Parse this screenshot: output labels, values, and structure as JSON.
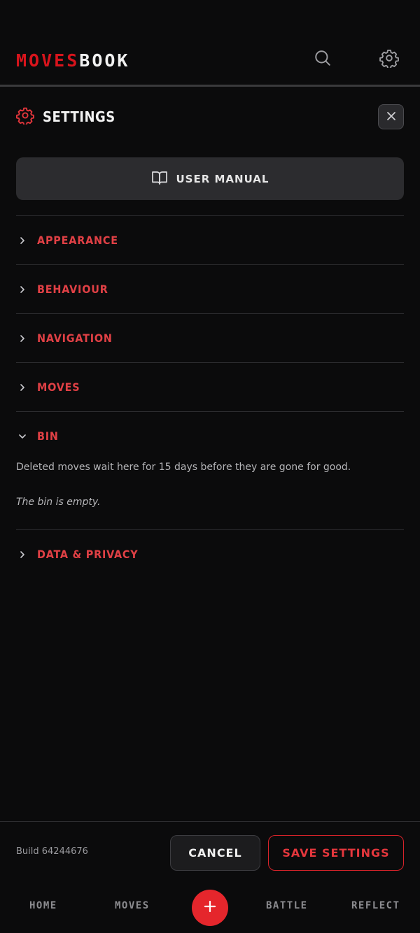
{
  "header": {
    "logo_red": "MOVES",
    "logo_white": "BOOK"
  },
  "settings": {
    "title": "SETTINGS",
    "manual_label": "USER MANUAL",
    "sections": [
      {
        "label": "APPEARANCE",
        "expanded": false
      },
      {
        "label": "BEHAVIOUR",
        "expanded": false
      },
      {
        "label": "NAVIGATION",
        "expanded": false
      },
      {
        "label": "MOVES",
        "expanded": false
      },
      {
        "label": "BIN",
        "expanded": true
      },
      {
        "label": "DATA & PRIVACY",
        "expanded": false
      }
    ],
    "bin": {
      "description": "Deleted moves wait here for 15 days before they are gone for good.",
      "empty_text": "The bin is empty."
    }
  },
  "footer": {
    "build": "Build 64244676",
    "cancel_label": "CANCEL",
    "save_label": "SAVE SETTINGS"
  },
  "nav": {
    "home": "HOME",
    "moves": "MOVES",
    "battle": "BATTLE",
    "reflect": "REFLECT"
  },
  "colors": {
    "accent": "#e5262c",
    "background": "#0b0b0c"
  },
  "icons": [
    "search-icon",
    "gear-icon",
    "close-icon",
    "book-icon",
    "chevron-right-icon",
    "chevron-down-icon",
    "plus-icon"
  ]
}
